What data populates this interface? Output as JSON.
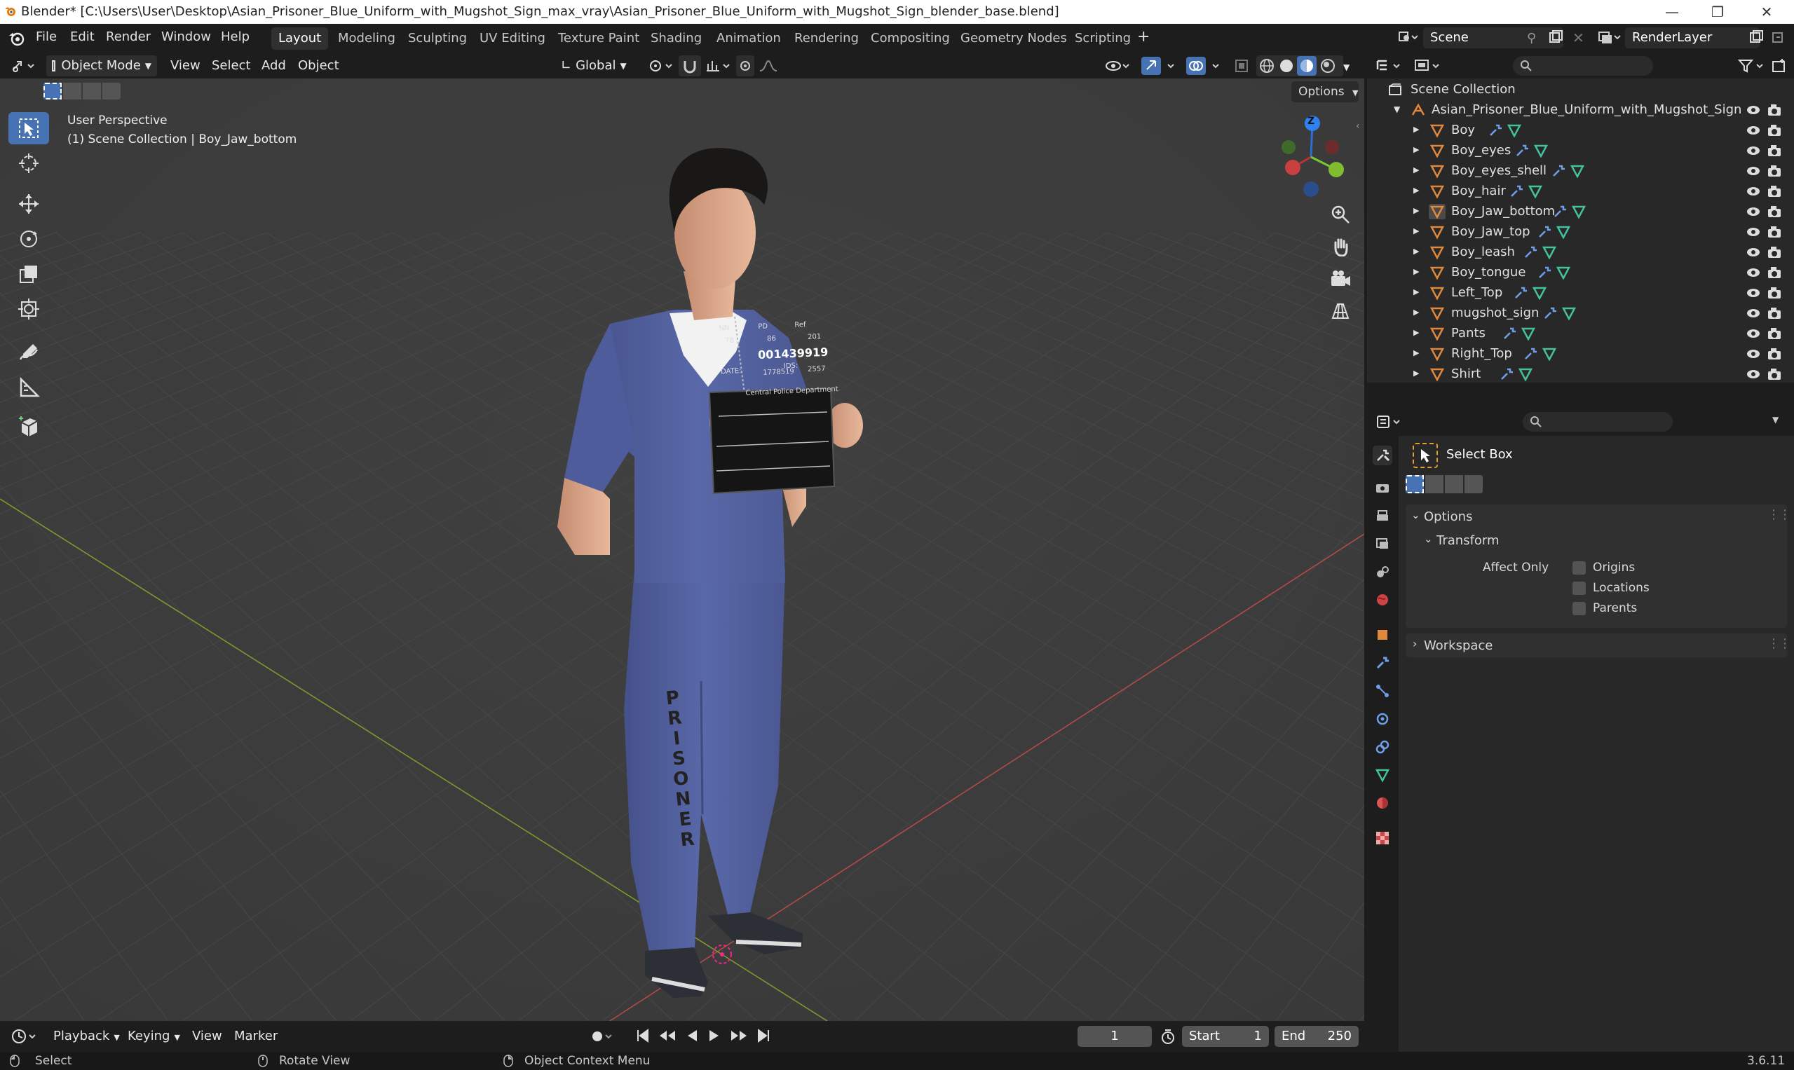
{
  "window": {
    "title": "Blender* [C:\\Users\\User\\Desktop\\Asian_Prisoner_Blue_Uniform_with_Mugshot_Sign_max_vray\\Asian_Prisoner_Blue_Uniform_with_Mugshot_Sign_blender_base.blend]"
  },
  "menu": [
    "File",
    "Edit",
    "Render",
    "Window",
    "Help"
  ],
  "workspaces": [
    "Layout",
    "Modeling",
    "Sculpting",
    "UV Editing",
    "Texture Paint",
    "Shading",
    "Animation",
    "Rendering",
    "Compositing",
    "Geometry Nodes",
    "Scripting"
  ],
  "active_workspace": "Layout",
  "scene": {
    "name": "Scene",
    "view_layer": "RenderLayer"
  },
  "viewport_header": {
    "mode": "Object Mode",
    "menus": [
      "View",
      "Select",
      "Add",
      "Object"
    ],
    "orientation": "Global",
    "options_label": "Options"
  },
  "viewport": {
    "perspective_label": "User Perspective",
    "context_label": "(1) Scene Collection | Boy_Jaw_bottom",
    "axis_z": "Z",
    "mugshot": {
      "number": "001439919",
      "department": "Central Police Department",
      "labels": [
        "NN",
        "PD",
        "Ref",
        "78",
        "86",
        "201",
        "DATE:",
        "1778519",
        "IDS:",
        "2557"
      ],
      "leg_text": [
        "P",
        "R",
        "I",
        "S",
        "O",
        "N",
        "E",
        "R"
      ]
    }
  },
  "outliner": {
    "scene_collection": "Scene Collection",
    "root": "Asian_Prisoner_Blue_Uniform_with_Mugshot_Sign",
    "objects": [
      "Boy",
      "Boy_eyes",
      "Boy_eyes_shell",
      "Boy_hair",
      "Boy_Jaw_bottom",
      "Boy_Jaw_top",
      "Boy_leash",
      "Boy_tongue",
      "Left_Top",
      "mugshot_sign",
      "Pants",
      "Right_Top",
      "Shirt"
    ],
    "active_object": "Boy_Jaw_bottom"
  },
  "properties": {
    "tool_name": "Select Box",
    "panel_options": "Options",
    "subpanel_transform": "Transform",
    "affect_only_label": "Affect Only",
    "checkboxes": [
      {
        "label": "Origins",
        "checked": false
      },
      {
        "label": "Locations",
        "checked": false
      },
      {
        "label": "Parents",
        "checked": false
      }
    ],
    "panel_workspace": "Workspace"
  },
  "timeline": {
    "menus": [
      "Playback",
      "Keying",
      "View",
      "Marker"
    ],
    "current_frame": "1",
    "start_label": "Start",
    "start": "1",
    "end_label": "End",
    "end": "250"
  },
  "statusbar": {
    "select": "Select",
    "rotate": "Rotate View",
    "context_menu": "Object Context Menu",
    "version": "3.6.11"
  },
  "colors": {
    "accent": "#4772b3",
    "viewport_bg": "#3d3d3d",
    "mesh_icon": "#e0893c",
    "modifier_icon": "#6e9fe8",
    "data_icon": "#43c29c",
    "grid_x_axis": "#b34a4a",
    "grid_y_axis": "#7a9a2e"
  }
}
